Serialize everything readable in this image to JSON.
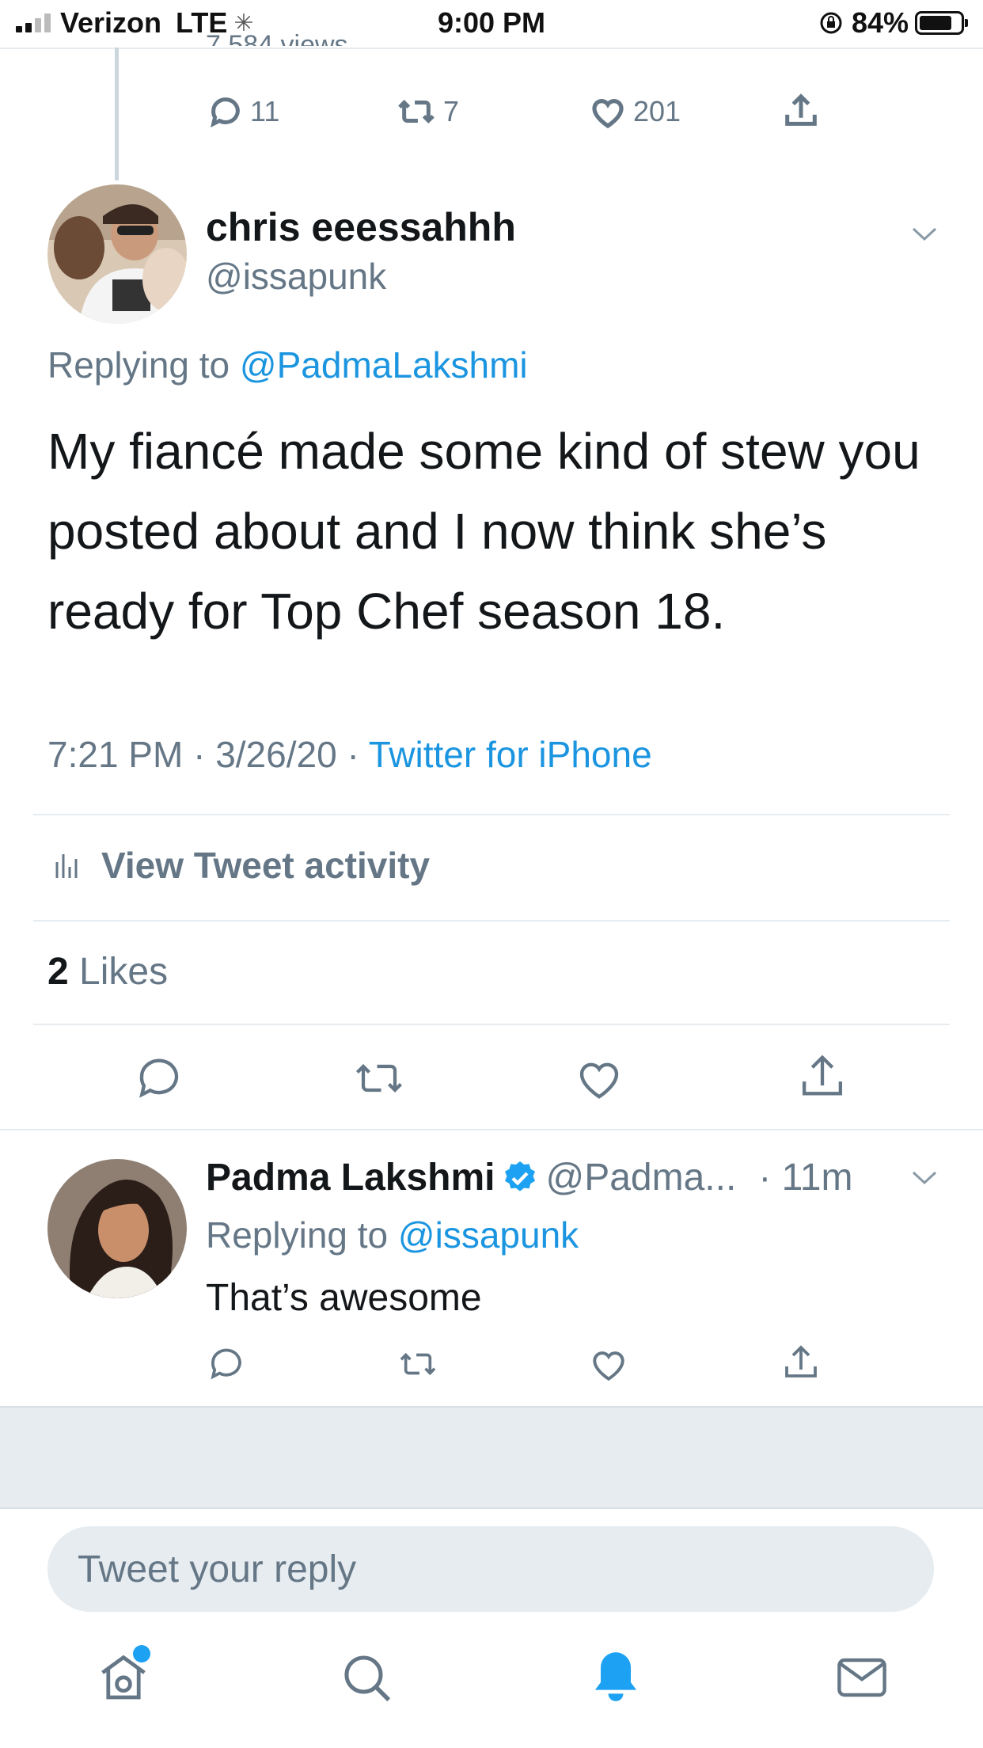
{
  "status_bar": {
    "carrier": "Verizon",
    "network": "LTE",
    "time": "9:00 PM",
    "battery": "84%",
    "battery_level": 0.84
  },
  "prev_tweet": {
    "cut_text": "7,584 views",
    "replies": "11",
    "retweets": "7",
    "likes": "201"
  },
  "main_tweet": {
    "name": "chris eeessahhh",
    "handle": "@issapunk",
    "replying_prefix": "Replying to ",
    "replying_to": "@PadmaLakshmi",
    "text": "My fiancé made some kind of stew you posted about and I now think she’s ready for Top Chef season 18.",
    "time": "7:21 PM · 3/26/20 · ",
    "source": "Twitter for iPhone",
    "activity": "View Tweet activity",
    "likes_count": "2",
    "likes_label": " Likes"
  },
  "reply": {
    "name": "Padma Lakshmi",
    "handle": "@Padma...",
    "time": "· 11m",
    "replying_prefix": "Replying to ",
    "replying_to": "@issapunk",
    "text": "That’s awesome"
  },
  "composer": {
    "placeholder": "Tweet your reply"
  },
  "tab_bar": {
    "items": [
      "home",
      "search",
      "notifications",
      "messages"
    ],
    "active": "notifications"
  },
  "colors": {
    "accent": "#1da1f2",
    "link": "#1b95e0",
    "secondary_text": "#657786",
    "divider": "#e6ecf0",
    "gray_band": "#e6ecf0"
  }
}
